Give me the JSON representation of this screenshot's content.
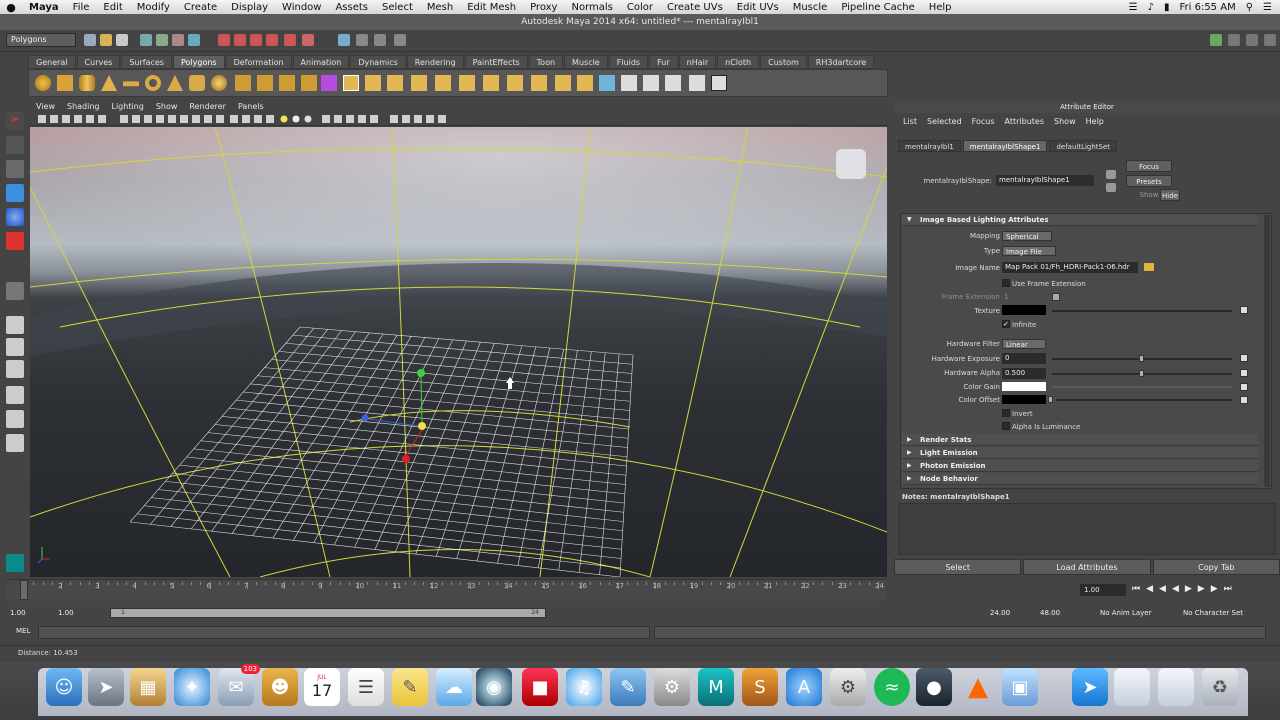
{
  "macmenu": {
    "apple": "",
    "items": [
      "Maya",
      "File",
      "Edit",
      "Modify",
      "Create",
      "Display",
      "Window",
      "Assets",
      "Select",
      "Mesh",
      "Edit Mesh",
      "Proxy",
      "Normals",
      "Color",
      "Create UVs",
      "Edit UVs",
      "Muscle",
      "Pipeline Cache",
      "Help"
    ],
    "clock": "Fri 6:55 AM"
  },
  "window_title": "Autodesk Maya 2014 x64: untitled*   ---   mentalrayIbl1",
  "status": {
    "mode": "Polygons"
  },
  "shelf_tabs": [
    "General",
    "Curves",
    "Surfaces",
    "Polygons",
    "Deformation",
    "Animation",
    "Dynamics",
    "Rendering",
    "PaintEffects",
    "Toon",
    "Muscle",
    "Fluids",
    "Fur",
    "nHair",
    "nCloth",
    "Custom",
    "RH3dartcore"
  ],
  "shelf_active": "Polygons",
  "viewport_menu": [
    "View",
    "Shading",
    "Lighting",
    "Show",
    "Renderer",
    "Panels"
  ],
  "attribute_editor": {
    "title": "Attribute Editor",
    "menu": [
      "List",
      "Selected",
      "Focus",
      "Attributes",
      "Show",
      "Help"
    ],
    "tabs": [
      "mentalrayIbl1",
      "mentalrayIblShape1",
      "defaultLightSet"
    ],
    "active_tab": "mentalrayIblShape1",
    "node_label": "mentalrayIblShape:",
    "node_value": "mentalrayIblShape1",
    "btn_focus": "Focus",
    "btn_presets": "Presets",
    "btn_show": "Show",
    "btn_hide": "Hide",
    "section_ibl": "Image Based Lighting Attributes",
    "mapping_label": "Mapping",
    "mapping_value": "Spherical",
    "type_label": "Type",
    "type_value": "Image File",
    "image_name_label": "Image Name",
    "image_name_value": "Map Pack 01/Fh_HDRI-Pack1-06.hdr",
    "use_frame_ext": "Use Frame Extension",
    "frame_ext_label": "Frame Extension",
    "frame_ext_value": "1",
    "texture_label": "Texture",
    "infinite_label": "Infinite",
    "hw_filter_label": "Hardware Filter",
    "hw_filter_value": "Linear",
    "hw_exposure_label": "Hardware Exposure",
    "hw_exposure_value": "0",
    "hw_alpha_label": "Hardware Alpha",
    "hw_alpha_value": "0.500",
    "color_gain_label": "Color Gain",
    "color_offset_label": "Color Offset",
    "invert_label": "Invert",
    "alpha_lum_label": "Alpha Is Luminance",
    "sections_collapsed": [
      "Render Stats",
      "Light Emission",
      "Photon Emission",
      "Node Behavior"
    ],
    "notes": "Notes:  mentalrayIblShape1",
    "bottom_buttons": [
      "Select",
      "Load Attributes",
      "Copy Tab"
    ]
  },
  "timeline": {
    "ticks": [
      "1",
      "2",
      "3",
      "4",
      "5",
      "6",
      "7",
      "8",
      "9",
      "10",
      "11",
      "12",
      "13",
      "14",
      "15",
      "16",
      "17",
      "18",
      "19",
      "20",
      "21",
      "22",
      "23",
      "24"
    ],
    "current": "1.00",
    "range_start": "1.00",
    "range_start2": "1.00",
    "range_handle_start": "1",
    "range_handle_end": "24",
    "range_end": "24.00",
    "range_end2": "48.00",
    "anim_layer": "No Anim Layer",
    "char_set": "No Character Set"
  },
  "cmdline": {
    "label": "MEL"
  },
  "helpline": {
    "text": "Distance:  10.453"
  },
  "dock": {
    "calendar_day": "17",
    "mail_badge": "103",
    "calendar_month": "JUL"
  },
  "colors": {
    "accent_tab": "#676767",
    "grid": "#d4d43a",
    "swatch_white": "#ffffff",
    "swatch_black": "#000000"
  }
}
